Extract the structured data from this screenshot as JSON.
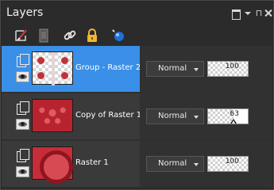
{
  "panel": {
    "title": "Layers",
    "title_buttons": [
      "restore-icon",
      "menu-arrow-icon",
      "pin-icon",
      "close-icon"
    ],
    "pin_glyph": "⊓"
  },
  "toolbar": {
    "tools": [
      "brush-layer-icon",
      "mask-layer-icon",
      "link-icon",
      "lock-icon",
      "properties-icon"
    ]
  },
  "layers": [
    {
      "name": "Group - Raster 2",
      "blend_mode": "Normal",
      "opacity": "100",
      "opacity_level": 1.0,
      "selected": true,
      "thumbnail": "checker-with-red-blots"
    },
    {
      "name": "Copy of Raster 1",
      "blend_mode": "Normal",
      "opacity": "63",
      "opacity_level": 0.63,
      "selected": false,
      "thumbnail": "red-lace"
    },
    {
      "name": "Raster 1",
      "blend_mode": "Normal",
      "opacity": "100",
      "opacity_level": 1.0,
      "selected": false,
      "thumbnail": "red-ring"
    }
  ],
  "colors": {
    "selection": "#3a8fe8",
    "panel_bg": "#262626",
    "row_bg": "#3a3a3a"
  }
}
